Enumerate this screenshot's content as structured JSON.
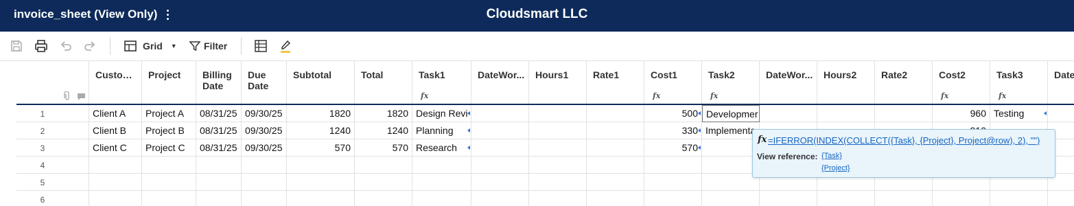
{
  "header": {
    "sheet_title": "invoice_sheet (View Only)",
    "company": "Cloudsmart LLC"
  },
  "toolbar": {
    "view_label": "Grid",
    "filter_label": "Filter"
  },
  "columns": [
    {
      "label": "Custom...",
      "fx": false
    },
    {
      "label": "Project",
      "fx": false
    },
    {
      "label": "Billing\nDate",
      "fx": false
    },
    {
      "label": "Due\nDate",
      "fx": false
    },
    {
      "label": "Subtotal",
      "fx": false
    },
    {
      "label": "Total",
      "fx": false
    },
    {
      "label": "Task1",
      "fx": true
    },
    {
      "label": "DateWor...",
      "fx": false
    },
    {
      "label": "Hours1",
      "fx": false
    },
    {
      "label": "Rate1",
      "fx": false
    },
    {
      "label": "Cost1",
      "fx": true
    },
    {
      "label": "Task2",
      "fx": true
    },
    {
      "label": "DateWor...",
      "fx": false
    },
    {
      "label": "Hours2",
      "fx": false
    },
    {
      "label": "Rate2",
      "fx": false
    },
    {
      "label": "Cost2",
      "fx": true
    },
    {
      "label": "Task3",
      "fx": true
    },
    {
      "label": "Date",
      "fx": false
    }
  ],
  "rows": [
    {
      "num": "1",
      "cells": [
        "Client A",
        "Project A",
        "08/31/25",
        "09/30/25",
        "1820",
        "1820",
        "Design Revi",
        "",
        "",
        "",
        "500",
        "Developmer",
        "",
        "",
        "",
        "960",
        "Testing",
        ""
      ]
    },
    {
      "num": "2",
      "cells": [
        "Client B",
        "Project B",
        "08/31/25",
        "09/30/25",
        "1240",
        "1240",
        "Planning",
        "",
        "",
        "",
        "330",
        "Implementa",
        "",
        "",
        "",
        "910",
        "",
        ""
      ]
    },
    {
      "num": "3",
      "cells": [
        "Client C",
        "Project C",
        "08/31/25",
        "09/30/25",
        "570",
        "570",
        "Research",
        "",
        "",
        "",
        "570",
        "",
        "",
        "",
        "",
        "",
        "",
        ""
      ]
    },
    {
      "num": "4",
      "cells": []
    },
    {
      "num": "5",
      "cells": []
    },
    {
      "num": "6",
      "cells": []
    }
  ],
  "formula_popover": {
    "formula": "=IFERROR(INDEX(COLLECT({Task}, {Project}, Project@row), 2), \"\")",
    "view_reference_label": "View reference:",
    "references": [
      "{Task}",
      "{Project}"
    ]
  }
}
